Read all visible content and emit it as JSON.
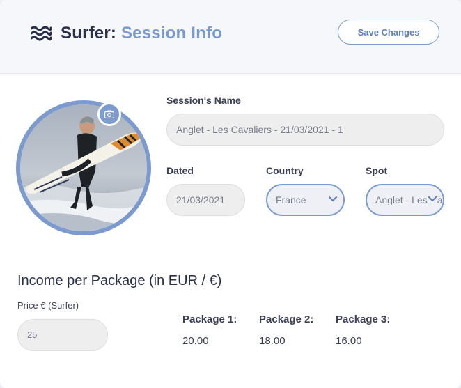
{
  "header": {
    "title_app": "Surfer:",
    "title_page": "Session Info",
    "save_label": "Save Changes"
  },
  "form": {
    "session_name_label": "Session's Name",
    "session_name_value": "Anglet - Les Cavaliers - 21/03/2021 - 1",
    "dated_label": "Dated",
    "dated_value": "21/03/2021",
    "country_label": "Country",
    "country_value": "France",
    "spot_label": "Spot",
    "spot_value": "Anglet - Les Cavaliers"
  },
  "income": {
    "title": "Income per Package (in EUR / €)",
    "price_label": "Price € (Surfer)",
    "price_value": "25",
    "packages": [
      {
        "label": "Package 1:",
        "value": "20.00"
      },
      {
        "label": "Package 2:",
        "value": "18.00"
      },
      {
        "label": "Package 3:",
        "value": "16.00"
      }
    ]
  },
  "icons": {
    "logo": "waves-icon",
    "avatar_edit": "camera-icon",
    "select_arrow": "chevron-down-icon"
  },
  "colors": {
    "accent": "#7b9ad0",
    "text_dark": "#2a2f4a",
    "header_bg": "#f5f7fb",
    "field_bg": "#eeeeee"
  }
}
